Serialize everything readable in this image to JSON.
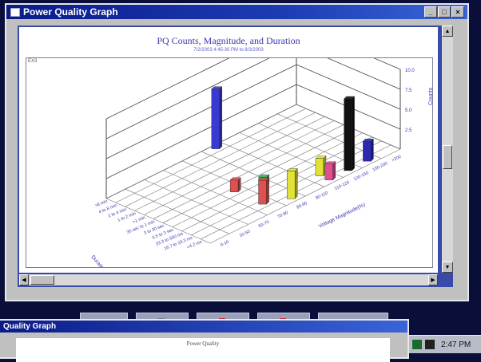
{
  "window": {
    "title": "Power Quality Graph",
    "buttons": {
      "minimize": "_",
      "maximize": "□",
      "close": "×"
    }
  },
  "chart": {
    "title": "PQ Counts, Magnitude, and Duration",
    "subtitle": "7/2/2003 4:45:30 PM to 8/3/2003",
    "tag": "EX3",
    "z_ticks": [
      "10.0",
      "7.5",
      "5.0",
      "2.5"
    ],
    "z_label": "Counts",
    "x_label": "Voltage Magnitude(%)",
    "x_ticks": [
      "0-10",
      "10-50",
      "50-70",
      "70-80",
      "80-90",
      "90-110",
      "110-120",
      "120-150",
      "150-200",
      ">200"
    ],
    "y_label": "Duration",
    "y_ticks": [
      "<4.2 ms",
      "16.7 to 33.3 ms",
      "33.3 to 500 ms",
      "0.5 to 3 sec",
      "3 to 30 sec",
      "30 sec to 1 min",
      ">1 min",
      "1 to 2 min",
      "2 to 4 min",
      "4 to 8 min",
      ">8 min"
    ]
  },
  "chart_data": {
    "type": "bar",
    "title": "PQ Counts, Magnitude, and Duration",
    "zlabel": "Counts",
    "xlabel": "Voltage Magnitude(%)",
    "ylabel": "Duration",
    "zlim": [
      0,
      10
    ],
    "bars": [
      {
        "x": "80-90",
        "y": "<4.2 ms",
        "value": 3.5,
        "color": "#e1e138"
      },
      {
        "x": "70-80",
        "y": "16.7 to 33.3 ms",
        "value": 3.0,
        "color": "#e05050"
      },
      {
        "x": "90-110",
        "y": "33.3 to 500 ms",
        "value": 1.0,
        "color": "#e1e138"
      },
      {
        "x": "80-90",
        "y": "0.5 to 3 sec",
        "value": 1.2,
        "color": "#36c24a"
      },
      {
        "x": "70-80",
        "y": "3 to 30 sec",
        "value": 1.5,
        "color": "#e05050"
      },
      {
        "x": "110-120",
        "y": "<4.2 ms",
        "value": 2.0,
        "color": "#e05090"
      },
      {
        "x": "110-120",
        "y": "16.7 to 33.3 ms",
        "value": 2.2,
        "color": "#e1e138"
      },
      {
        "x": "120-150",
        "y": "<4.2 ms",
        "value": 9.0,
        "color": "#111111"
      },
      {
        "x": "150-200",
        "y": "<4.2 ms",
        "value": 2.5,
        "color": "#2a2ab0"
      },
      {
        "x": "90-110",
        "y": ">8 min",
        "value": 7.5,
        "color": "#3a3ad0"
      }
    ]
  },
  "bottom_buttons": [
    "",
    "",
    "",
    "",
    ""
  ],
  "window2": {
    "title": "Quality Graph",
    "chart_title": "Power Quality"
  },
  "tray": {
    "clock": "2:47 PM"
  }
}
